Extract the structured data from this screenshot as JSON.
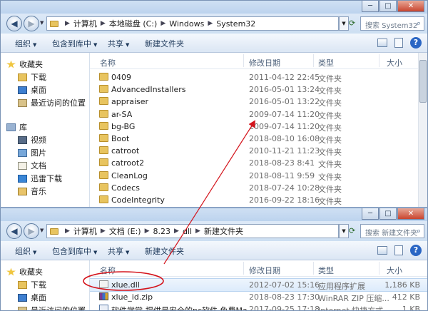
{
  "window_top": {
    "controls": [
      "─",
      "□",
      "✕"
    ],
    "breadcrumb": [
      "计算机",
      "本地磁盘 (C:)",
      "Windows",
      "System32"
    ],
    "search_placeholder": "搜索 System32",
    "toolbar": {
      "organize": "组织",
      "include_library": "包含到库中",
      "share": "共享",
      "new_folder": "新建文件夹"
    },
    "nav": {
      "favorites": "收藏夹",
      "favorites_items": [
        "下载",
        "桌面",
        "最近访问的位置"
      ],
      "libraries": "库",
      "library_items": [
        "视频",
        "图片",
        "文档",
        "迅雷下载",
        "音乐"
      ]
    },
    "columns": {
      "name": "名称",
      "date": "修改日期",
      "type": "类型",
      "size": "大小"
    },
    "files": [
      {
        "name": "0409",
        "date": "2011-04-12 22:45",
        "type": "文件夹"
      },
      {
        "name": "AdvancedInstallers",
        "date": "2016-05-01 13:24",
        "type": "文件夹"
      },
      {
        "name": "appraiser",
        "date": "2016-05-01 13:22",
        "type": "文件夹"
      },
      {
        "name": "ar-SA",
        "date": "2009-07-14 11:20",
        "type": "文件夹"
      },
      {
        "name": "bg-BG",
        "date": "2009-07-14 11:20",
        "type": "文件夹"
      },
      {
        "name": "Boot",
        "date": "2018-08-10 16:08",
        "type": "文件夹"
      },
      {
        "name": "catroot",
        "date": "2010-11-21 11:23",
        "type": "文件夹"
      },
      {
        "name": "catroot2",
        "date": "2018-08-23 8:41",
        "type": "文件夹"
      },
      {
        "name": "CleanLog",
        "date": "2018-08-11 9:59",
        "type": "文件夹"
      },
      {
        "name": "Codecs",
        "date": "2018-07-24 10:28",
        "type": "文件夹"
      },
      {
        "name": "CodeIntegrity",
        "date": "2016-09-22 18:16",
        "type": "文件夹"
      }
    ]
  },
  "window_bottom": {
    "controls": [
      "─",
      "□",
      "✕"
    ],
    "breadcrumb": [
      "计算机",
      "文档 (E:)",
      "8.23",
      "dll",
      "新建文件夹"
    ],
    "search_placeholder": "搜索 新建文件夹",
    "toolbar": {
      "organize": "组织",
      "include_library": "包含到库中",
      "share": "共享",
      "new_folder": "新建文件夹"
    },
    "nav": {
      "favorites": "收藏夹",
      "favorites_items": [
        "下载",
        "桌面",
        "最近访问的位置"
      ]
    },
    "columns": {
      "name": "名称",
      "date": "修改日期",
      "type": "类型",
      "size": "大小"
    },
    "files": [
      {
        "name": "xlue.dll",
        "date": "2012-07-02 15:16",
        "type": "应用程序扩展",
        "size": "1,186 KB"
      },
      {
        "name": "xlue_id.zip",
        "date": "2018-08-23 17:30",
        "type": "WinRAR ZIP 压缩...",
        "size": "412 KB"
      },
      {
        "name": "软件学堂-提供最安全的pc软件 免费Ma...",
        "date": "2017-09-25 17:18",
        "type": "Internet 快捷方式",
        "size": "1 KB"
      }
    ]
  },
  "annotation": {
    "circle_color": "#d4141c",
    "arrow_color": "#d4141c"
  }
}
